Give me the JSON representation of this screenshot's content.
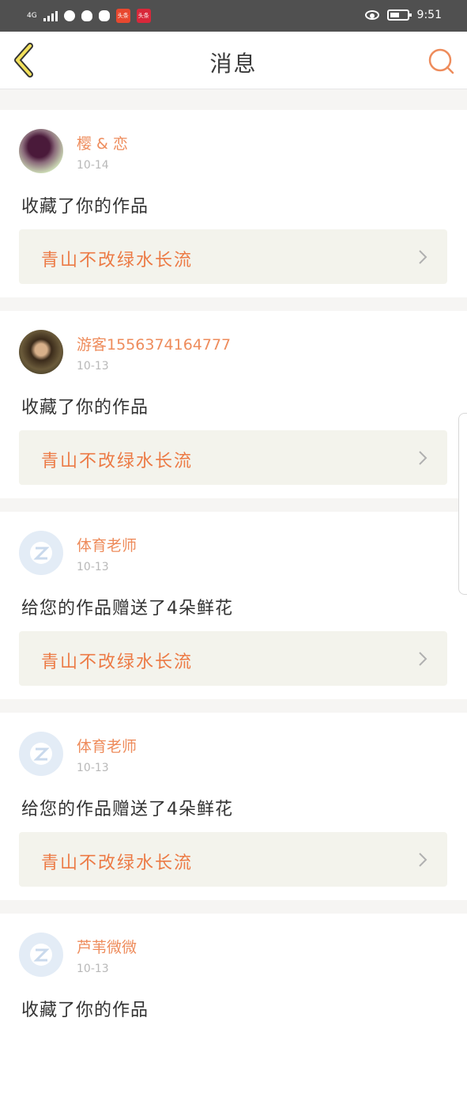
{
  "status_bar": {
    "network": "4G",
    "time": "9:51",
    "app_badge_1": "头条",
    "app_badge_2": "头条"
  },
  "nav": {
    "title": "消息"
  },
  "messages": [
    {
      "username": "樱 & 恋",
      "date": "10-14",
      "action": "收藏了你的作品",
      "work_title": "青山不改绿水长流",
      "avatar": "photo"
    },
    {
      "username": "游客1556374164777",
      "date": "10-13",
      "action": "收藏了你的作品",
      "work_title": "青山不改绿水长流",
      "avatar": "photo"
    },
    {
      "username": "体育老师",
      "date": "10-13",
      "action": "给您的作品赠送了4朵鲜花",
      "work_title": "青山不改绿水长流",
      "avatar": "default-qq"
    },
    {
      "username": "体育老师",
      "date": "10-13",
      "action": "给您的作品赠送了4朵鲜花",
      "work_title": "青山不改绿水长流",
      "avatar": "default-qq"
    },
    {
      "username": "芦苇微微",
      "date": "10-13",
      "action": "收藏了你的作品",
      "work_title": "",
      "avatar": "default-qq"
    }
  ],
  "colors": {
    "accent": "#ee8c5c",
    "work_bg": "#f3f3ec",
    "work_title": "#ec7a45"
  }
}
